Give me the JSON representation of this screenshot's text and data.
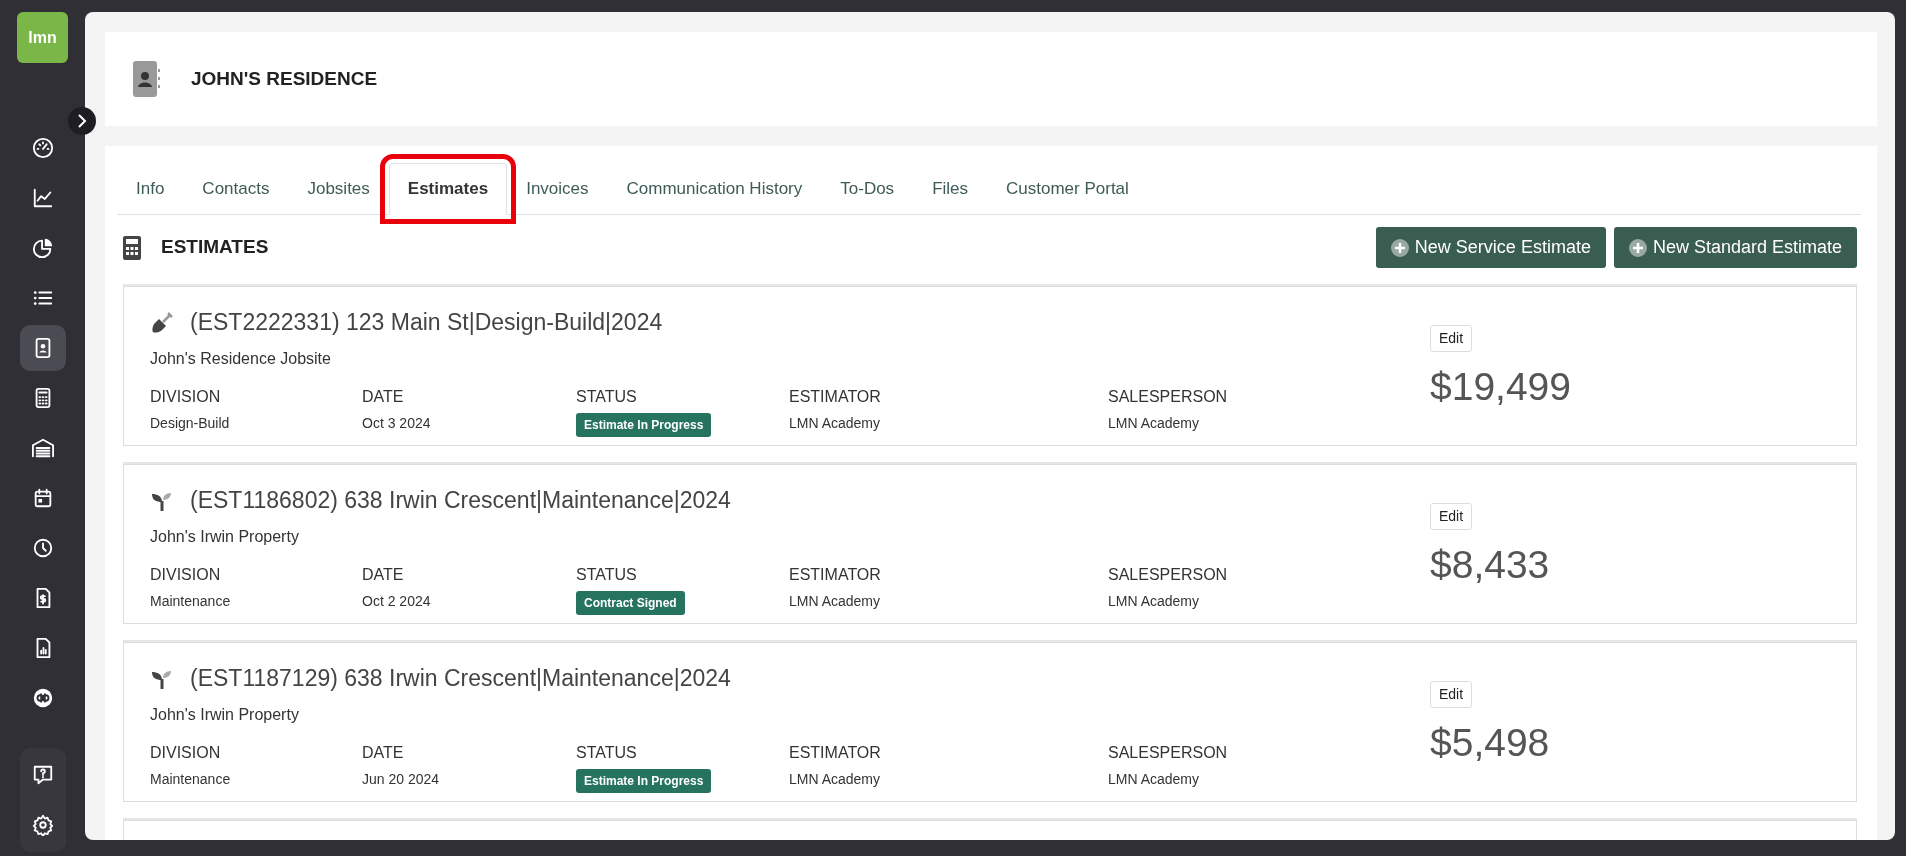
{
  "logo": {
    "text": "lmn"
  },
  "sidebar": {
    "items": [
      {
        "selected": false
      },
      {
        "selected": false
      },
      {
        "selected": false
      },
      {
        "selected": false
      },
      {
        "selected": true
      },
      {
        "selected": false
      },
      {
        "selected": false
      },
      {
        "selected": false
      },
      {
        "selected": false
      },
      {
        "selected": false
      },
      {
        "selected": false
      },
      {
        "selected": false
      }
    ],
    "bottom_items": [
      {
        "selected": false
      },
      {
        "selected": false
      }
    ]
  },
  "header": {
    "title": "JOHN'S RESIDENCE"
  },
  "tabs": [
    {
      "label": "Info",
      "selected": false,
      "highlighted": false
    },
    {
      "label": "Contacts",
      "selected": false,
      "highlighted": false
    },
    {
      "label": "Jobsites",
      "selected": false,
      "highlighted": false
    },
    {
      "label": "Estimates",
      "selected": true,
      "highlighted": true
    },
    {
      "label": "Invoices",
      "selected": false,
      "highlighted": false
    },
    {
      "label": "Communication History",
      "selected": false,
      "highlighted": false
    },
    {
      "label": "To-Dos",
      "selected": false,
      "highlighted": false
    },
    {
      "label": "Files",
      "selected": false,
      "highlighted": false
    },
    {
      "label": "Customer Portal",
      "selected": false,
      "highlighted": false
    }
  ],
  "section": {
    "title": "ESTIMATES",
    "buttons": [
      "New Service Estimate",
      "New Standard Estimate"
    ]
  },
  "estimates": [
    {
      "kind": "design-build",
      "title": "(EST2222331) 123 Main St|Design-Build|2024",
      "jobsite": "John's Residence Jobsite",
      "fields": [
        {
          "kind": "text",
          "label": "DIVISION",
          "value": "Design-Build"
        },
        {
          "kind": "text",
          "label": "DATE",
          "value": "Oct 3 2024"
        },
        {
          "kind": "badge",
          "label": "STATUS",
          "value": "Estimate In Progress"
        },
        {
          "kind": "text",
          "label": "ESTIMATOR",
          "value": "LMN Academy"
        },
        {
          "kind": "text",
          "label": "SALESPERSON",
          "value": "LMN Academy"
        }
      ],
      "edit": "Edit",
      "amount": "$19,499"
    },
    {
      "kind": "maintenance",
      "title": "(EST1186802) 638 Irwin Crescent|Maintenance|2024",
      "jobsite": "John's Irwin Property",
      "fields": [
        {
          "kind": "text",
          "label": "DIVISION",
          "value": "Maintenance"
        },
        {
          "kind": "text",
          "label": "DATE",
          "value": "Oct 2 2024"
        },
        {
          "kind": "badge",
          "label": "STATUS",
          "value": "Contract Signed"
        },
        {
          "kind": "text",
          "label": "ESTIMATOR",
          "value": "LMN Academy"
        },
        {
          "kind": "text",
          "label": "SALESPERSON",
          "value": "LMN Academy"
        }
      ],
      "edit": "Edit",
      "amount": "$8,433"
    },
    {
      "kind": "maintenance",
      "title": "(EST1187129) 638 Irwin Crescent|Maintenance|2024",
      "jobsite": "John's Irwin Property",
      "fields": [
        {
          "kind": "text",
          "label": "DIVISION",
          "value": "Maintenance"
        },
        {
          "kind": "text",
          "label": "DATE",
          "value": "Jun 20 2024"
        },
        {
          "kind": "badge",
          "label": "STATUS",
          "value": "Estimate In Progress"
        },
        {
          "kind": "text",
          "label": "ESTIMATOR",
          "value": "LMN Academy"
        },
        {
          "kind": "text",
          "label": "SALESPERSON",
          "value": "LMN Academy"
        }
      ],
      "edit": "Edit",
      "amount": "$5,498"
    }
  ]
}
